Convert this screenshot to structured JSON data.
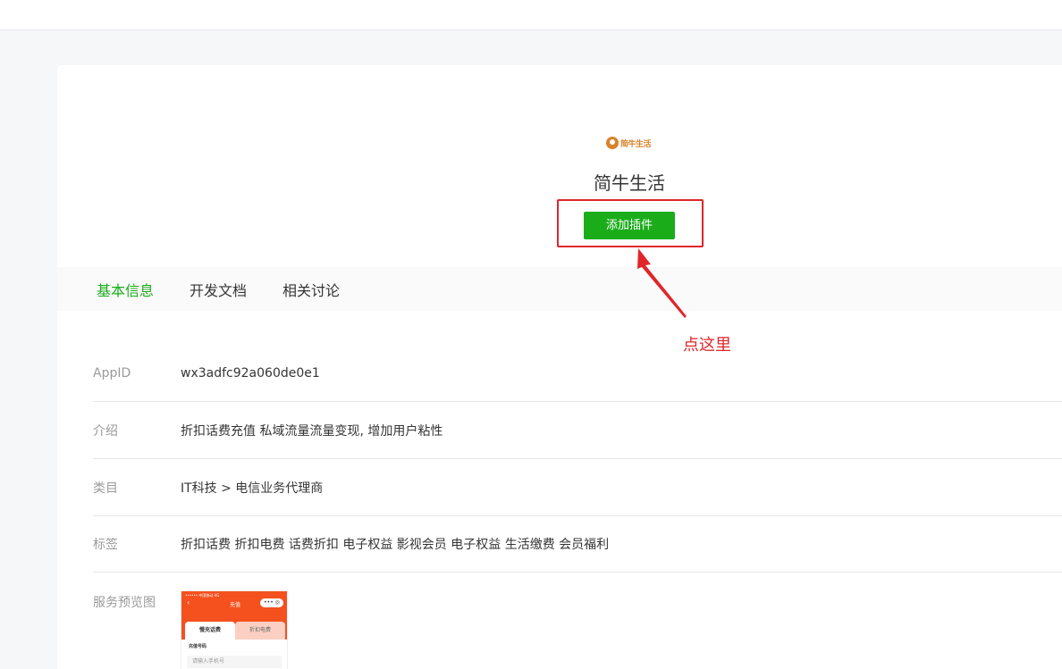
{
  "app": {
    "logo_text": "简牛生活",
    "name": "简牛生活",
    "add_button_label": "添加插件"
  },
  "tabs": [
    {
      "label": "基本信息",
      "active": true
    },
    {
      "label": "开发文档",
      "active": false
    },
    {
      "label": "相关讨论",
      "active": false
    }
  ],
  "info": {
    "appid_label": "AppID",
    "appid_value": "wx3adfc92a060de0e1",
    "intro_label": "介绍",
    "intro_value": "折扣话费充值 私域流量流量变现, 增加用户粘性",
    "category_label": "类目",
    "category_value": "IT科技 > 电信业务代理商",
    "tags_label": "标签",
    "tags_value": "折扣话费 折扣电费 话费折扣 电子权益 影视会员 电子权益 生活缴费 会员福利",
    "preview_label": "服务预览图"
  },
  "preview": {
    "status": "•••••• 中国移动 4G",
    "title": "充值",
    "capsule": "••• ◎",
    "tab_active": "慢充话费",
    "tab_other": "折扣电费",
    "field_label": "充值号码",
    "field_placeholder": "请输入手机号"
  },
  "annotation": {
    "text": "点这里",
    "color": "#e0262a"
  },
  "colors": {
    "accent": "#1aad19",
    "highlight": "#e0262a",
    "logo": "#d9822b",
    "preview_header": "#f4511e"
  }
}
